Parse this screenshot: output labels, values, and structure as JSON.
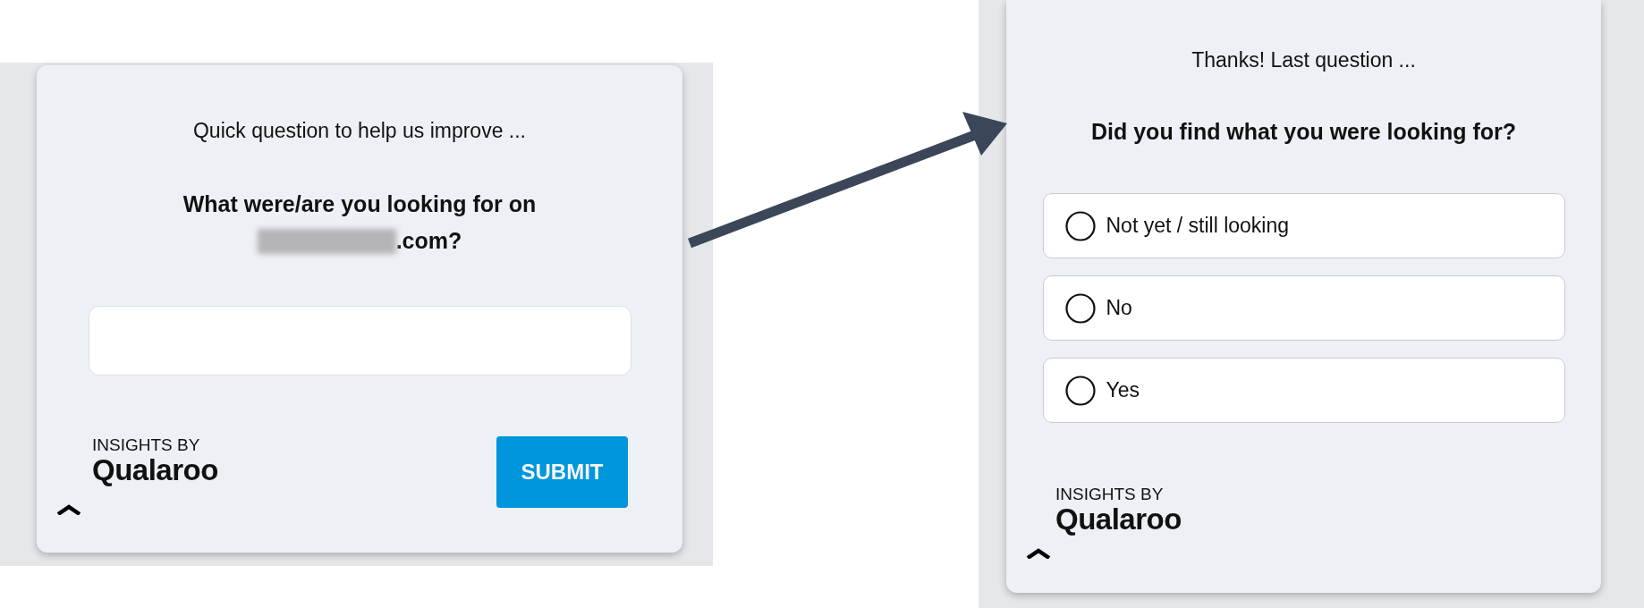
{
  "left_survey": {
    "intro": "Quick question to help us improve ...",
    "question": {
      "text": "What were/are you looking for on",
      "redacted_suffix": ".com?"
    },
    "branding": {
      "caption": "INSIGHTS BY",
      "brand": "Qualaroo"
    },
    "submit_button": "SUBMIT"
  },
  "right_survey": {
    "intro": "Thanks! Last question ...",
    "question": "Did you find what you were looking for?",
    "options": [
      {
        "label": "Not yet / still looking",
        "selected": false
      },
      {
        "label": "No",
        "selected": false
      },
      {
        "label": "Yes",
        "selected": false
      }
    ],
    "branding": {
      "caption": "INSIGHTS BY",
      "brand": "Qualaroo"
    }
  }
}
